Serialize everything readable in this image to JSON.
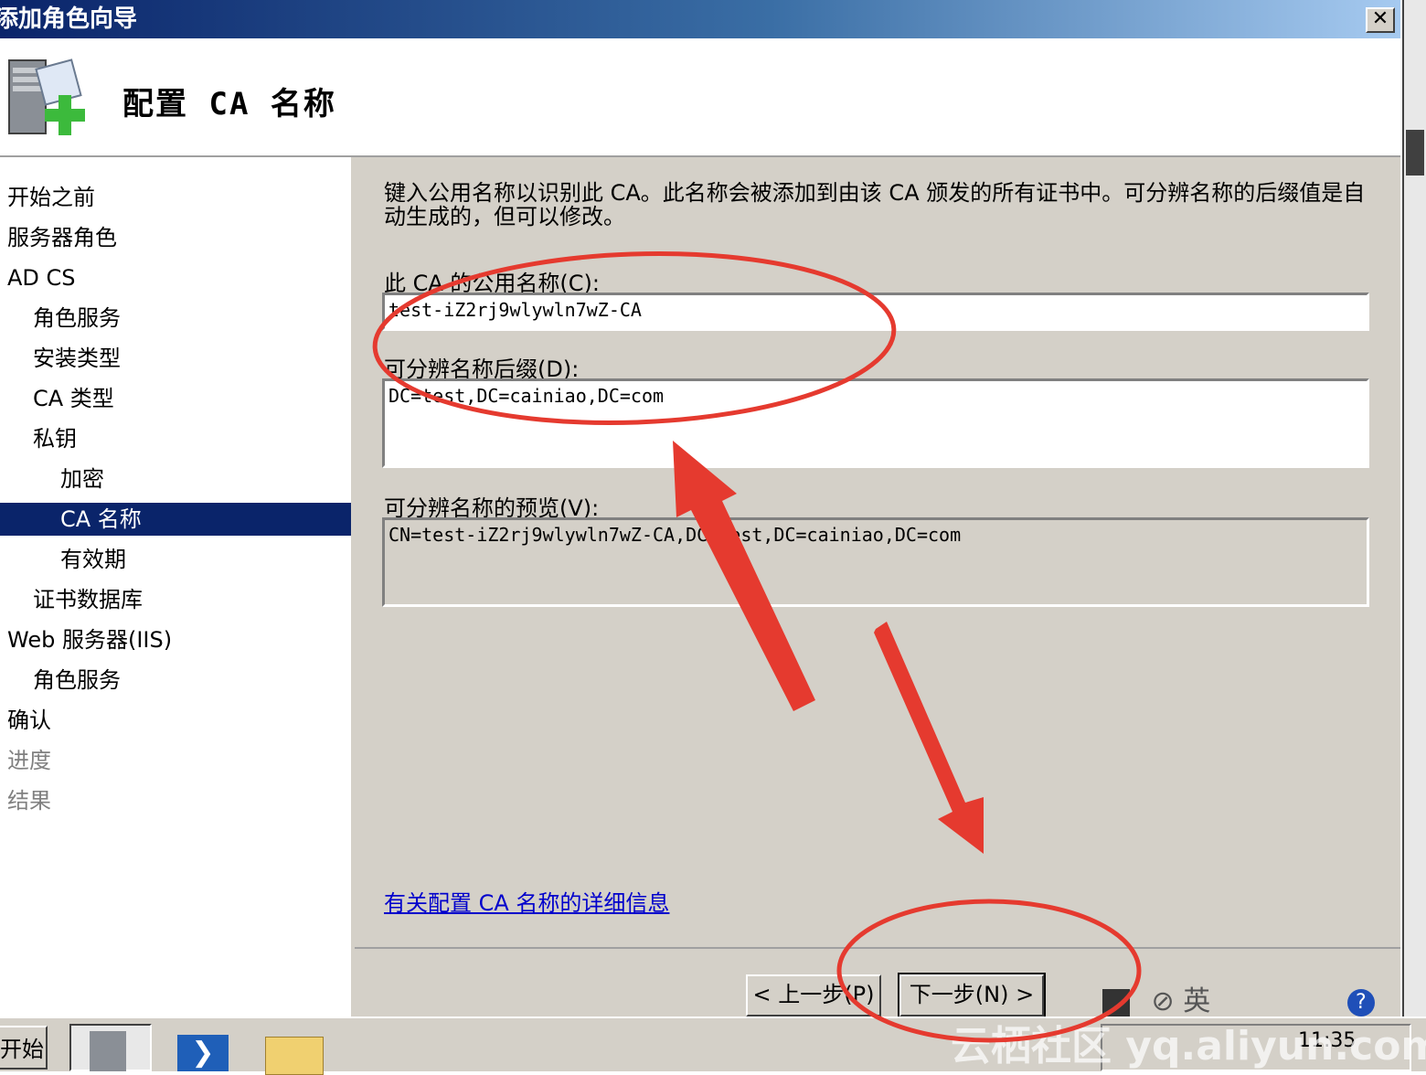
{
  "window": {
    "title": "添加角色向导",
    "close_glyph": "✕"
  },
  "header": {
    "title": "配置 CA 名称"
  },
  "nav": {
    "items": [
      {
        "label": "开始之前",
        "level": 0,
        "state": "normal"
      },
      {
        "label": "服务器角色",
        "level": 0,
        "state": "normal"
      },
      {
        "label": "AD CS",
        "level": 0,
        "state": "normal"
      },
      {
        "label": "角色服务",
        "level": 1,
        "state": "normal"
      },
      {
        "label": "安装类型",
        "level": 1,
        "state": "normal"
      },
      {
        "label": "CA 类型",
        "level": 1,
        "state": "normal"
      },
      {
        "label": "私钥",
        "level": 1,
        "state": "normal"
      },
      {
        "label": "加密",
        "level": 2,
        "state": "normal"
      },
      {
        "label": "CA 名称",
        "level": 2,
        "state": "selected"
      },
      {
        "label": "有效期",
        "level": 2,
        "state": "normal"
      },
      {
        "label": "证书数据库",
        "level": 1,
        "state": "normal"
      },
      {
        "label": "Web 服务器(IIS)",
        "level": 0,
        "state": "normal"
      },
      {
        "label": "角色服务",
        "level": 1,
        "state": "normal"
      },
      {
        "label": "确认",
        "level": 0,
        "state": "normal"
      },
      {
        "label": "进度",
        "level": 0,
        "state": "disabled"
      },
      {
        "label": "结果",
        "level": 0,
        "state": "disabled"
      }
    ]
  },
  "main": {
    "description": "键入公用名称以识别此 CA。此名称会被添加到由该 CA 颁发的所有证书中。可分辨名称的后缀值是自动生成的，但可以修改。",
    "common_name_label": "此 CA 的公用名称(C):",
    "common_name_value": "test-iZ2rj9wlywln7wZ-CA",
    "dn_suffix_label": "可分辨名称后缀(D):",
    "dn_suffix_value": "DC=test,DC=cainiao,DC=com",
    "preview_label": "可分辨名称的预览(V):",
    "preview_value": "CN=test-iZ2rj9wlywln7wZ-CA,DC=test,DC=cainiao,DC=com",
    "help_link": "有关配置 CA 名称的详细信息"
  },
  "buttons": {
    "back": "< 上一步(P)",
    "next": "下一步(N) >"
  },
  "taskbar": {
    "start": "开始",
    "clock": "11:35",
    "lang": "英"
  },
  "watermark": "云栖社区 yq.aliyun.com",
  "colors": {
    "selection": "#0a246a",
    "dialog_face": "#d4d0c8",
    "annotation": "#e53a2f",
    "link": "#0000cc"
  }
}
